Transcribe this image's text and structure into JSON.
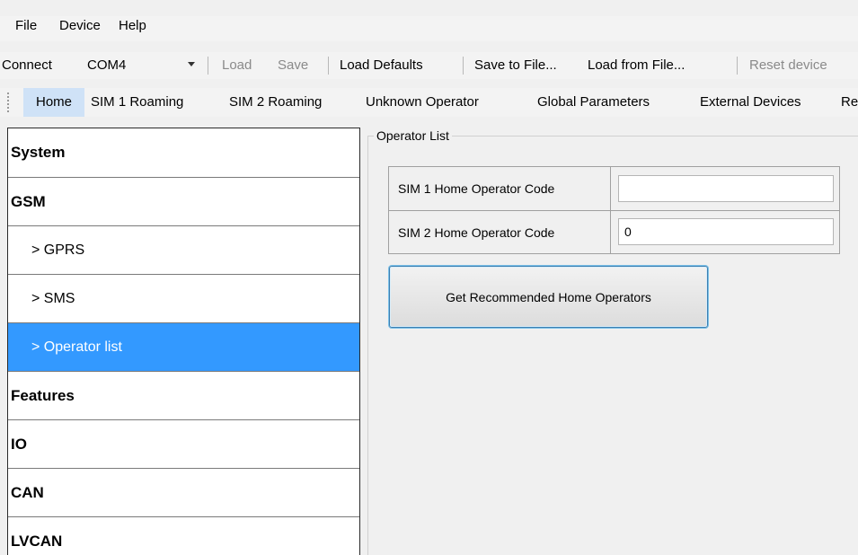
{
  "menu": {
    "items": [
      "File",
      "Device",
      "Help"
    ]
  },
  "toolbar": {
    "connect_label": "Connect",
    "port_value": "COM4",
    "load": "Load",
    "save": "Save",
    "load_defaults": "Load Defaults",
    "save_to_file": "Save to File...",
    "load_from_file": "Load from File...",
    "reset_device": "Reset device"
  },
  "tabs": [
    "Home",
    "SIM 1 Roaming",
    "SIM 2 Roaming",
    "Unknown Operator",
    "Global Parameters",
    "External Devices",
    "Re"
  ],
  "nav": {
    "items": [
      {
        "label": "System",
        "kind": "header"
      },
      {
        "label": "GSM",
        "kind": "header"
      },
      {
        "label": "> GPRS",
        "kind": "sub"
      },
      {
        "label": "> SMS",
        "kind": "sub"
      },
      {
        "label": "> Operator list",
        "kind": "sub",
        "selected": true
      },
      {
        "label": "Features",
        "kind": "header"
      },
      {
        "label": "IO",
        "kind": "header"
      },
      {
        "label": "CAN",
        "kind": "header"
      },
      {
        "label": "LVCAN",
        "kind": "header"
      }
    ]
  },
  "operator_list": {
    "title": "Operator List",
    "sim1_label": "SIM 1 Home Operator Code",
    "sim1_value": "",
    "sim2_label": "SIM 2 Home Operator Code",
    "sim2_value": "0",
    "recommend_button": "Get Recommended Home Operators"
  },
  "colors": {
    "selection": "#3399ff",
    "active_tab": "#cfe2f7",
    "button_border": "#3c7fb1"
  }
}
